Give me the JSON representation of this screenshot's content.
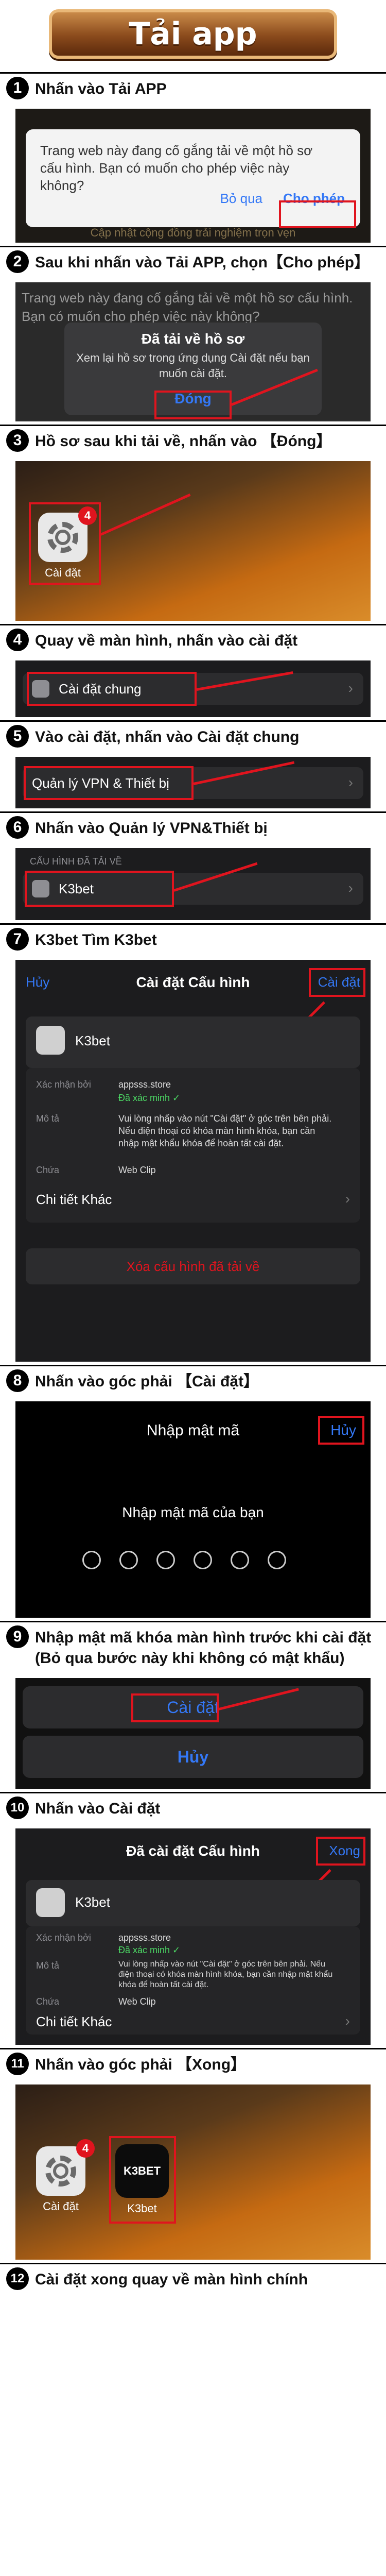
{
  "banner": {
    "title": "Tải app"
  },
  "steps": [
    {
      "num": "1",
      "caption": "Nhấn vào Tải APP"
    },
    {
      "num": "2",
      "caption": "Sau khi nhấn vào Tải APP, chọn【Cho phép】"
    },
    {
      "num": "3",
      "caption": "Hồ sơ sau khi tải về, nhấn vào 【Đóng】"
    },
    {
      "num": "4",
      "caption": "Quay về màn hình, nhấn vào cài đặt"
    },
    {
      "num": "5",
      "caption": "Vào cài đặt, nhấn vào Cài đặt chung"
    },
    {
      "num": "6",
      "caption": "Nhấn vào Quản lý VPN&Thiết bị"
    },
    {
      "num": "7",
      "caption": "K3bet Tìm K3bet"
    },
    {
      "num": "8",
      "caption": "Nhấn vào góc phải 【Cài đặt】"
    },
    {
      "num": "9",
      "caption": "Nhập mật mã khóa màn hình trước khi cài đặt (Bỏ qua bước này khi không có mật khẩu)"
    },
    {
      "num": "10",
      "caption": "Nhấn vào Cài đặt"
    },
    {
      "num": "11",
      "caption": "Nhấn vào góc phải 【Xong】"
    },
    {
      "num": "12",
      "caption": "Cài đặt xong quay về màn hình chính"
    }
  ],
  "s1": {
    "message": "Trang web này đang cố gắng tải về một hồ sơ cấu hình. Bạn có muốn cho phép việc này không?",
    "deny": "Bỏ qua",
    "allow": "Cho phép",
    "bg_text": "Cập nhật cộng đồng trải nghiệm trọn vẹn"
  },
  "s2": {
    "bg_text": "Trang web này đang cố gắng tải về một hồ sơ cấu hình. Bạn có muốn cho phép việc này không?",
    "title": "Đã tải về hồ sơ",
    "message": "Xem lại hồ sơ trong ứng dụng Cài đặt nếu bạn muốn cài đặt.",
    "button": "Đóng"
  },
  "s3": {
    "badge": "4",
    "label": "Cài đặt"
  },
  "s5": {
    "row": "Cài đặt chung",
    "chev": "›"
  },
  "s6": {
    "row": "Quản lý VPN & Thiết bị",
    "chev": "›"
  },
  "s7": {
    "section": "CẤU HÌNH ĐÃ TẢI VỀ",
    "row": "K3bet",
    "chev": "›"
  },
  "s8": {
    "cancel": "Hủy",
    "title": "Cài đặt Cấu hình",
    "install": "Cài đặt",
    "profile": "K3bet",
    "signed_key": "Xác nhận bởi",
    "signed_val": "appsss.store",
    "verified": "Đã xác minh ✓",
    "desc_key": "Mô tả",
    "desc_val": "Vui lòng nhấp vào nút \"Cài đặt\" ở góc trên bên phải. Nếu điện thoại có khóa màn hình khóa, bạn cần nhập mật khẩu khóa để hoàn tất cài đặt.",
    "contains_key": "Chứa",
    "contains_val": "Web Clip",
    "more": "Chi tiết Khác",
    "remove": "Xóa cấu hình đã tải về",
    "chev": "›"
  },
  "s9": {
    "title": "Nhập mật mã",
    "cancel": "Hủy",
    "prompt": "Nhập mật mã của bạn"
  },
  "s10": {
    "install": "Cài đặt",
    "cancel": "Hủy"
  },
  "s11": {
    "title": "Đã cài đặt Cấu hình",
    "done": "Xong",
    "profile": "K3bet",
    "signed_key": "Xác nhận bởi",
    "signed_val": "appsss.store",
    "verified": "Đã xác minh ✓",
    "desc_key": "Mô tả",
    "desc_val": "Vui lòng nhấp vào nút \"Cài đặt\" ở góc trên bên phải. Nếu điện thoại có khóa màn hình khóa, bạn cần nhập mật khẩu khóa để hoàn tất cài đặt.",
    "contains_key": "Chứa",
    "contains_val": "Web Clip",
    "more": "Chi tiết Khác",
    "chev": "›"
  },
  "s12": {
    "badge": "4",
    "settings_label": "Cài đặt",
    "app_icon_text": "K3BET",
    "app_label": "K3bet"
  }
}
